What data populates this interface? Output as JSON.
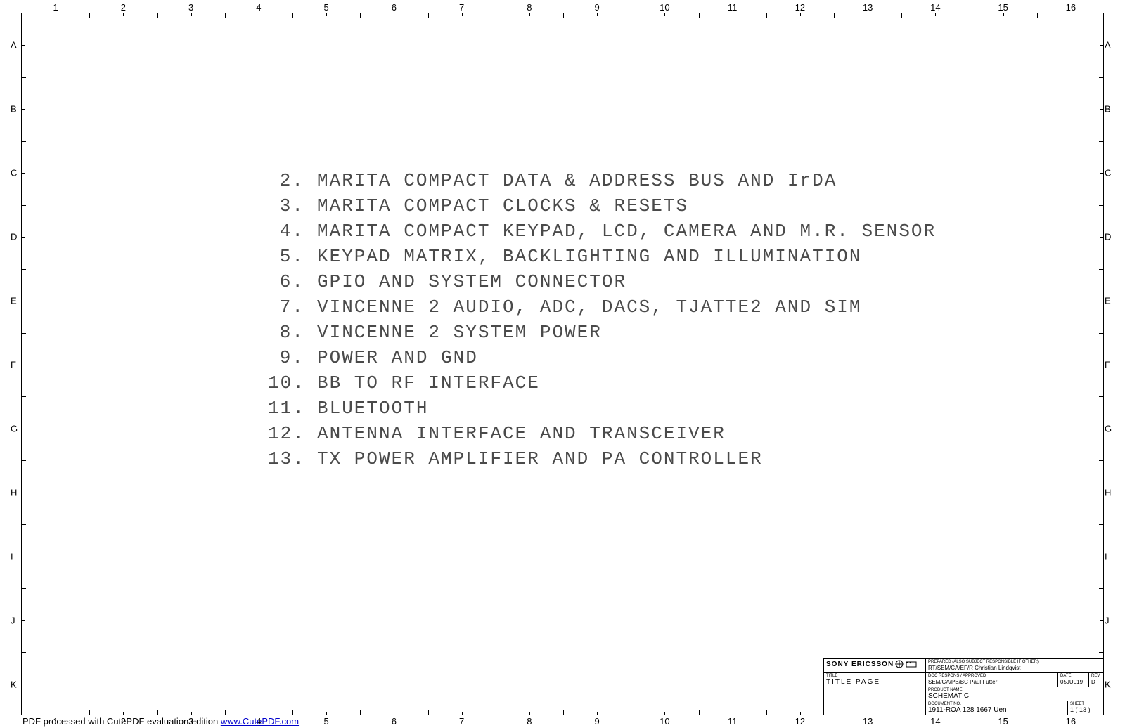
{
  "ruler": {
    "cols": [
      "1",
      "2",
      "3",
      "4",
      "5",
      "6",
      "7",
      "8",
      "9",
      "10",
      "11",
      "12",
      "13",
      "14",
      "15",
      "16"
    ],
    "rows": [
      "A",
      "B",
      "C",
      "D",
      "E",
      "F",
      "G",
      "H",
      "I",
      "J",
      "K"
    ]
  },
  "toc": [
    {
      "num": "2.",
      "title": "MARITA COMPACT DATA & ADDRESS BUS AND IrDA"
    },
    {
      "num": "3.",
      "title": "MARITA COMPACT CLOCKS & RESETS"
    },
    {
      "num": "4.",
      "title": "MARITA COMPACT KEYPAD, LCD, CAMERA AND M.R. SENSOR"
    },
    {
      "num": "5.",
      "title": "KEYPAD MATRIX, BACKLIGHTING AND ILLUMINATION"
    },
    {
      "num": "6.",
      "title": "GPIO AND SYSTEM CONNECTOR"
    },
    {
      "num": "7.",
      "title": "VINCENNE 2 AUDIO, ADC, DACS, TJATTE2 AND SIM"
    },
    {
      "num": "8.",
      "title": "VINCENNE 2 SYSTEM POWER"
    },
    {
      "num": "9.",
      "title": "POWER AND GND"
    },
    {
      "num": "10.",
      "title": "BB TO RF INTERFACE"
    },
    {
      "num": "11.",
      "title": "BLUETOOTH"
    },
    {
      "num": "12.",
      "title": "ANTENNA INTERFACE AND TRANSCEIVER"
    },
    {
      "num": "13.",
      "title": "TX POWER AMPLIFIER AND PA CONTROLLER"
    }
  ],
  "title_block": {
    "company": "SONY ERICSSON",
    "title_label": "TITLE",
    "title_value": "TITLE PAGE",
    "prepared_label": "PREPARED (ALSO SUBJECT RESPONSIBLE IF OTHER)",
    "prepared_value": "RT/SEM/CA/EF/R Christian Lindqvist",
    "approved_label": "DOC RESPONS / APPROVED",
    "approved_value": "SEM/CA/PB/BC Paul Futter",
    "date_label": "DATE",
    "date_value": "05JUL19",
    "rev_label": "REV",
    "rev_value": "D",
    "product_label": "PRODUCT NAME",
    "product_value": "SCHEMATIC",
    "docno_label": "DOCUMENT NO.",
    "docno_value": "1911-ROA 128 1667 Uen",
    "sheet_label": "SHEET",
    "sheet_value": "1 ( 13 )"
  },
  "footer": {
    "prefix": "PDF processed with CutePDF evaluation edition ",
    "link_text": "www.CutePDF.com",
    "link_href": "http://www.CutePDF.com"
  }
}
